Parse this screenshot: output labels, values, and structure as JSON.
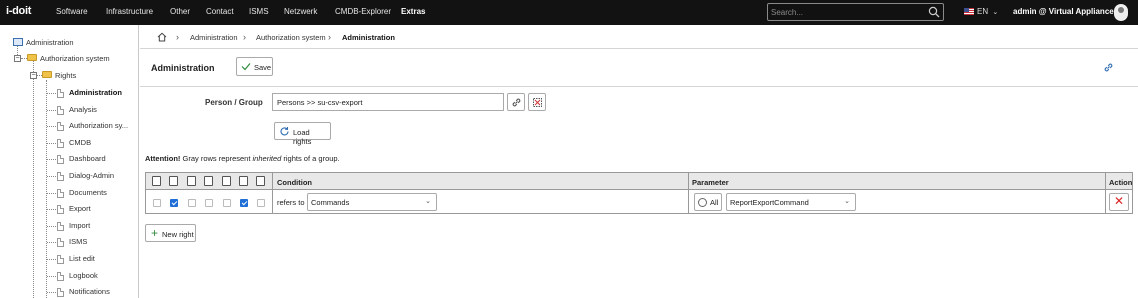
{
  "topnav": {
    "logo": "i-doit",
    "menu": [
      {
        "label": "Software"
      },
      {
        "label": "Infrastructure"
      },
      {
        "label": "Other"
      },
      {
        "label": "Contact"
      },
      {
        "label": "ISMS"
      },
      {
        "label": "Netzwerk"
      },
      {
        "label": "CMDB-Explorer"
      },
      {
        "label": "Extras"
      }
    ],
    "active_menu": "Extras",
    "search_placeholder": "Search...",
    "language": "EN",
    "user": "admin @ Virtual Appliance"
  },
  "sidebar": {
    "root": "Administration",
    "auth_system": "Authorization system",
    "rights": "Rights",
    "items": [
      {
        "label": "Administration",
        "selected": true
      },
      {
        "label": "Analysis"
      },
      {
        "label": "Authorization sy..."
      },
      {
        "label": "CMDB"
      },
      {
        "label": "Dashboard"
      },
      {
        "label": "Dialog-Admin"
      },
      {
        "label": "Documents"
      },
      {
        "label": "Export"
      },
      {
        "label": "Import"
      },
      {
        "label": "ISMS"
      },
      {
        "label": "List edit"
      },
      {
        "label": "Logbook"
      },
      {
        "label": "Notifications"
      }
    ]
  },
  "breadcrumb": {
    "items": [
      "Administration",
      "Authorization system"
    ],
    "current": "Administration"
  },
  "header": {
    "title": "Administration",
    "save_label": "Save"
  },
  "form": {
    "person_group_label": "Person / Group",
    "person_group_value": "Persons >> su-csv-export",
    "load_rights_label": "Load rights"
  },
  "attention": {
    "strong": "Attention!",
    "text_before": " Gray rows represent ",
    "emphasis": "inherited",
    "text_after": " rights of a group."
  },
  "table": {
    "headers": {
      "condition": "Condition",
      "parameter": "Parameter",
      "action": "Action"
    },
    "permission_icons": [
      "view-icon",
      "create-icon",
      "edit-icon",
      "archive-icon",
      "delete-icon",
      "execute-icon",
      "supervisor-icon"
    ],
    "rows": [
      {
        "permissions": [
          false,
          true,
          false,
          false,
          false,
          true,
          false
        ],
        "condition_prefix": "refers to",
        "condition_value": "Commands",
        "all_label": "All",
        "all_selected": false,
        "parameter_value": "ReportExportCommand"
      }
    ]
  },
  "new_right_label": "New right",
  "colors": {
    "topnav_bg": "#121212",
    "checkbox_checked": "#1f6fd6",
    "delete_red": "#dd2222",
    "link_blue": "#2f6db3"
  }
}
